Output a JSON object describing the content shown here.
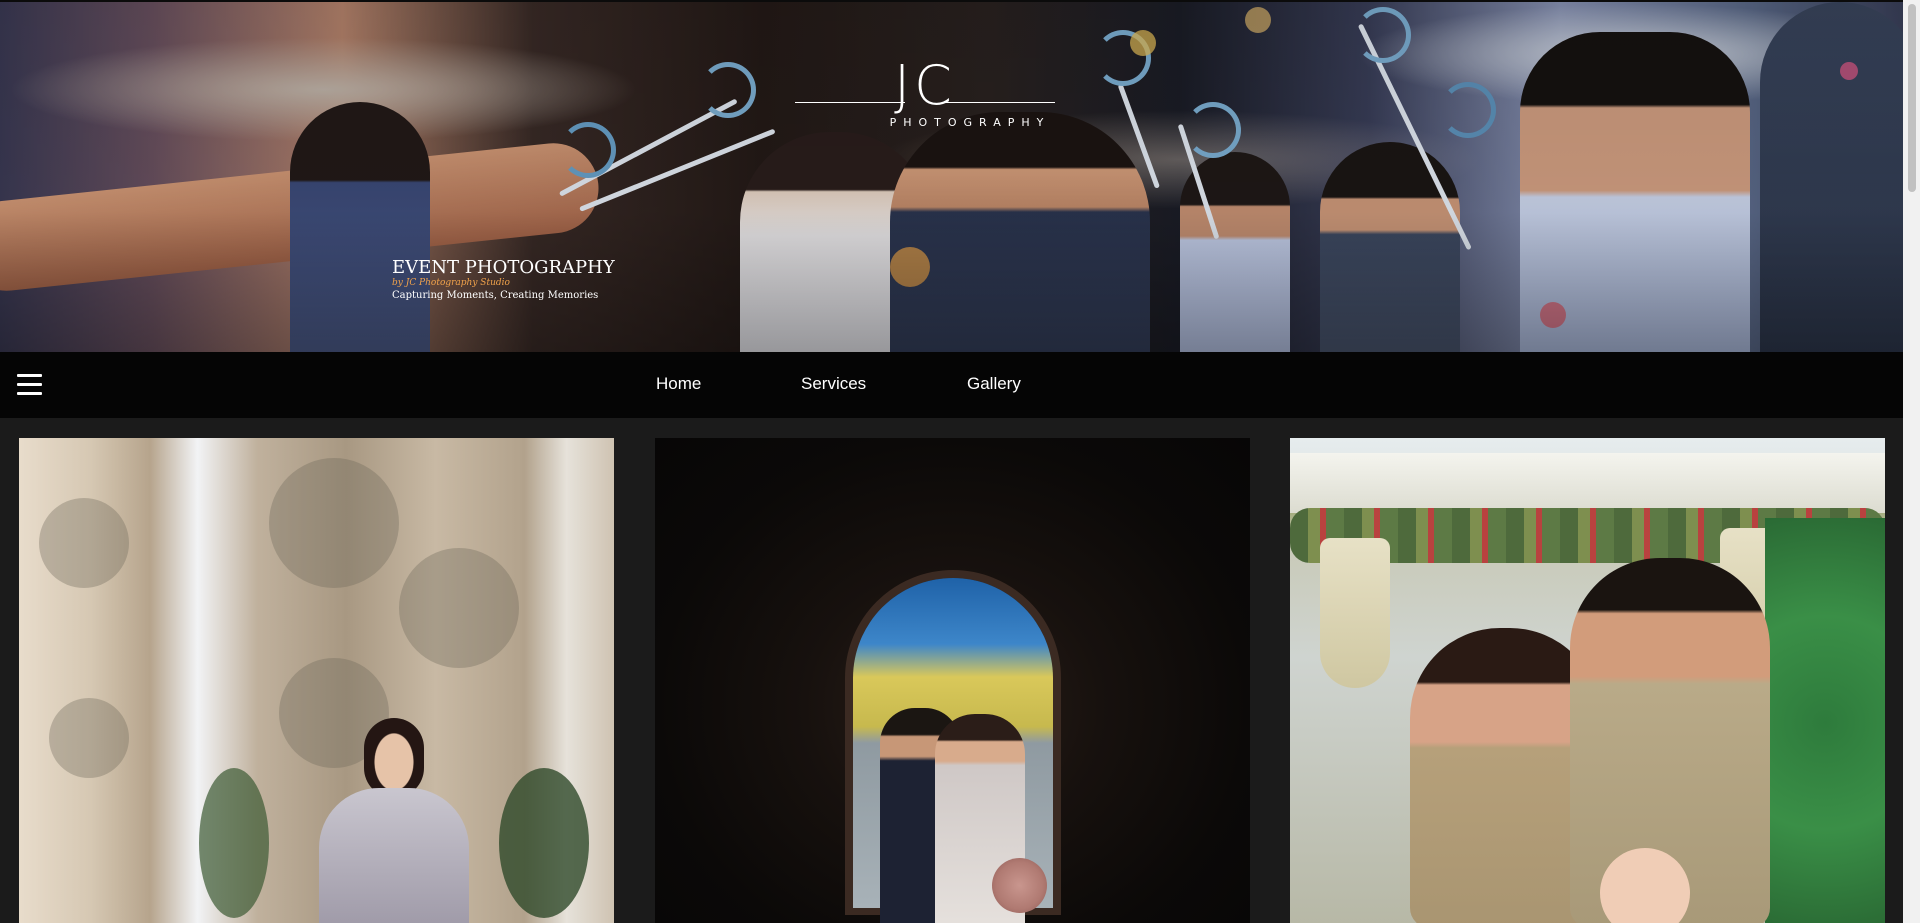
{
  "logo": {
    "mark": "JC",
    "subtitle": "PHOTOGRAPHY"
  },
  "hero": {
    "title": "EVENT PHOTOGRAPHY",
    "studio": "by JC Photography Studio",
    "tagline": "Capturing Moments, Creating Memories"
  },
  "nav": {
    "menu_icon": "hamburger-icon",
    "links": [
      {
        "label": "Home"
      },
      {
        "label": "Services"
      },
      {
        "label": "Gallery"
      }
    ]
  },
  "gallery": {
    "items": [
      {
        "subject": "portrait-photo"
      },
      {
        "subject": "couple-arch-photo"
      },
      {
        "subject": "family-christmas-photo"
      }
    ]
  },
  "colors": {
    "nav_background": "#050505",
    "page_background": "#1b1b1b",
    "text": "#ffffff",
    "studio_accent": "#f0a24b"
  }
}
